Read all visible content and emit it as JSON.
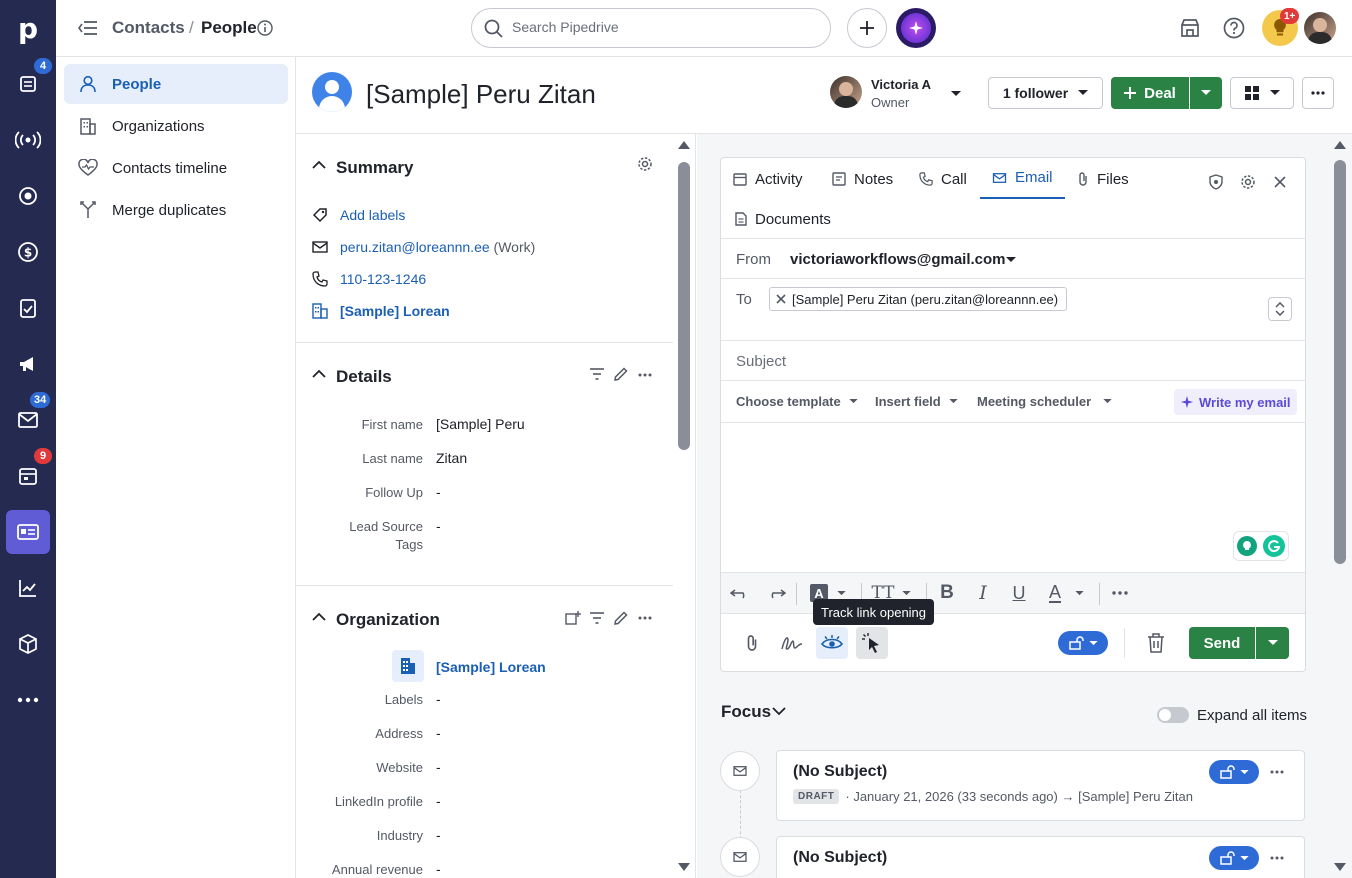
{
  "rail": {
    "logo": "p",
    "badges": {
      "leads": "4",
      "mail": "34",
      "activities": "9"
    }
  },
  "topbar": {
    "breadcrumb_parent": "Contacts",
    "breadcrumb_sep": "/",
    "breadcrumb_current": "People",
    "search_placeholder": "Search Pipedrive",
    "notification_badge": "1+"
  },
  "sidebar": {
    "items": [
      {
        "label": "People"
      },
      {
        "label": "Organizations"
      },
      {
        "label": "Contacts timeline"
      },
      {
        "label": "Merge duplicates"
      }
    ]
  },
  "header": {
    "person_name": "[Sample] Peru Zitan",
    "owner_name": "Victoria A",
    "owner_role": "Owner",
    "follower_label": "1 follower",
    "deal_label": "Deal"
  },
  "summary": {
    "title": "Summary",
    "add_labels": "Add labels",
    "email": "peru.zitan@loreannn.ee",
    "email_type": "(Work)",
    "phone": "110-123-1246",
    "organization": "[Sample] Lorean"
  },
  "details": {
    "title": "Details",
    "fields": [
      {
        "label": "First name",
        "value": "[Sample] Peru"
      },
      {
        "label": "Last name",
        "value": "Zitan"
      },
      {
        "label": "Follow Up",
        "value": "-"
      },
      {
        "label": "Lead Source",
        "label2": "Tags",
        "value": "-"
      }
    ]
  },
  "organization": {
    "title": "Organization",
    "name": "[Sample] Lorean",
    "fields": [
      {
        "label": "Labels",
        "value": "-"
      },
      {
        "label": "Address",
        "value": "-"
      },
      {
        "label": "Website",
        "value": "-"
      },
      {
        "label": "LinkedIn profile",
        "value": "-"
      },
      {
        "label": "Industry",
        "value": "-"
      },
      {
        "label": "Annual revenue",
        "value": "-"
      }
    ]
  },
  "composer": {
    "tabs": [
      {
        "label": "Activity"
      },
      {
        "label": "Notes"
      },
      {
        "label": "Call"
      },
      {
        "label": "Email"
      },
      {
        "label": "Files"
      },
      {
        "label": "Documents"
      }
    ],
    "from_label": "From",
    "from_value": "victoriaworkflows@gmail.com",
    "to_label": "To",
    "to_chip": "[Sample] Peru Zitan (peru.zitan@loreannn.ee)",
    "subject_placeholder": "Subject",
    "choose_template": "Choose template",
    "insert_field": "Insert field",
    "meeting_scheduler": "Meeting scheduler",
    "write_my_email": "Write my email",
    "tooltip": "Track link opening",
    "send_label": "Send"
  },
  "focus": {
    "title": "Focus",
    "expand_label": "Expand all items",
    "items": [
      {
        "title": "(No Subject)",
        "badge": "DRAFT",
        "meta": "· January 21, 2026 (33 seconds ago) → [Sample] Peru Zitan"
      },
      {
        "title": "(No Subject)"
      }
    ]
  },
  "colors": {
    "rail": "#252a50",
    "accent_blue": "#1a5fb4",
    "green": "#2a8344",
    "active_rail": "#5f5cd6"
  }
}
